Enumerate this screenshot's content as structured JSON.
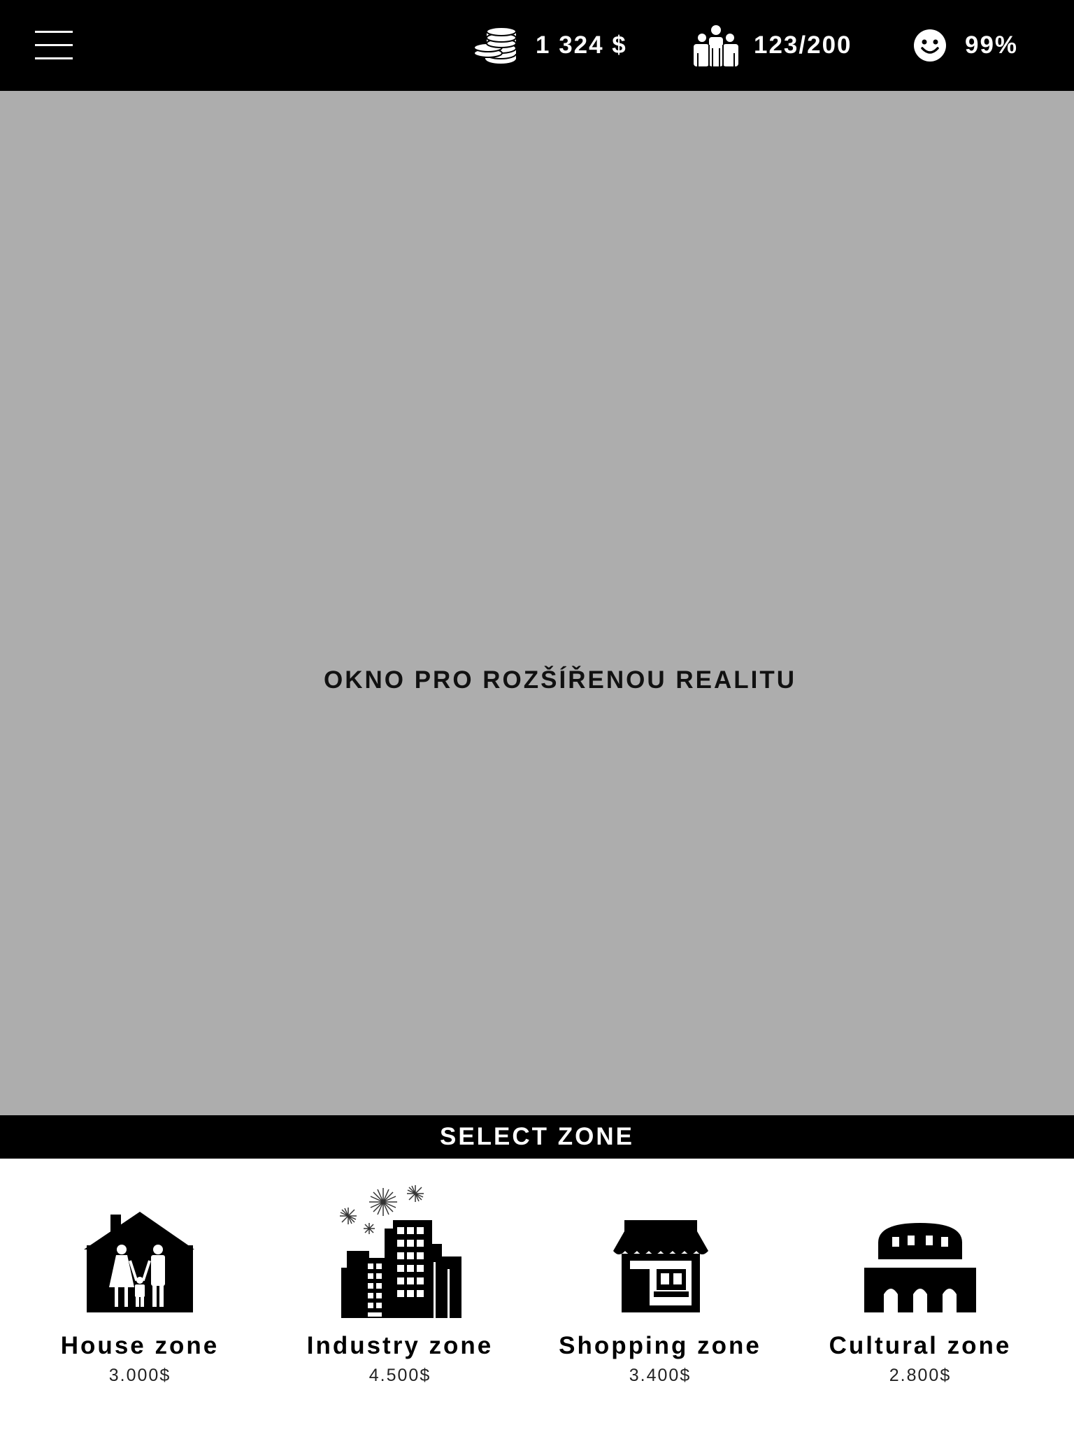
{
  "hud": {
    "menu_icon": "hamburger-menu-icon",
    "money": {
      "icon": "coins-stack-icon",
      "value": "1 324 $"
    },
    "population": {
      "icon": "people-group-icon",
      "value": "123/200"
    },
    "happiness": {
      "icon": "smiley-face-icon",
      "value": "99%"
    }
  },
  "ar_window": {
    "label": "OKNO PRO ROZŠÍŘENOU REALITU",
    "background": "#adadad"
  },
  "zone_picker": {
    "title": "SELECT ZONE",
    "zones": [
      {
        "name": "House zone",
        "price": "3.000$",
        "icon": "family-house-icon"
      },
      {
        "name": "Industry zone",
        "price": "4.500$",
        "icon": "city-buildings-fireworks-icon"
      },
      {
        "name": "Shopping zone",
        "price": "3.400$",
        "icon": "shop-storefront-icon"
      },
      {
        "name": "Cultural zone",
        "price": "2.800$",
        "icon": "colosseum-icon"
      }
    ]
  }
}
